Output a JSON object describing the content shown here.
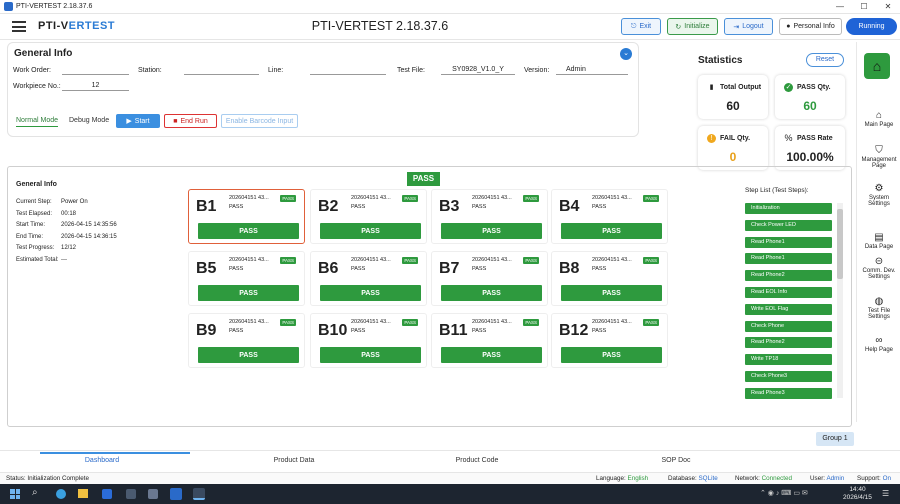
{
  "window": {
    "title": "PTI-VERTEST 2.18.37.6",
    "min": "—",
    "max": "☐",
    "close": "✕"
  },
  "header": {
    "logo_prefix": "PTI-V",
    "logo_suffix": "ERTEST",
    "app_title": "PTI-VERTEST 2.18.37.6",
    "buttons": {
      "exit": "Exit",
      "initialize": "Initialize",
      "logout": "Logout",
      "personal_info": "Personal Info",
      "running": "Running"
    }
  },
  "general_info": {
    "title": "General Info",
    "work_order_label": "Work Order:",
    "work_order": "",
    "station_label": "Station:",
    "station": "",
    "line_label": "Line:",
    "line": "",
    "test_file_label": "Test File:",
    "test_file": "SY0928_V1.0_Y",
    "version_label": "Version:",
    "version": "Admin",
    "workpiece_label": "Workpiece No.:",
    "workpiece": "12"
  },
  "statistics": {
    "title": "Statistics",
    "reset": "Reset",
    "total_output_label": "Total Output",
    "total_output": "60",
    "pass_qty_label": "PASS Qty.",
    "pass_qty": "60",
    "fail_qty_label": "FAIL Qty.",
    "fail_qty": "0",
    "pass_rate_label": "PASS Rate",
    "pass_rate": "100.00%"
  },
  "modes": {
    "normal": "Normal Mode",
    "debug": "Debug Mode",
    "start": "Start",
    "end_run": "End Run",
    "barcode": "Enable Barcode Input"
  },
  "overall_status": "PASS",
  "run_info": {
    "title": "General Info",
    "current_step_label": "Current Step:",
    "current_step": "Power On",
    "elapsed_label": "Test Elapsed:",
    "elapsed": "00:18",
    "start_label": "Start Time:",
    "start": "2026-04-15 14:35:56",
    "end_label": "End Time:",
    "end": "2026-04-15 14:36:15",
    "progress_label": "Test Progress:",
    "progress": "12/12",
    "estimated_label": "Estimated Total:",
    "estimated": "---"
  },
  "slots": [
    {
      "name": "B1",
      "serial": "202604151 43...",
      "status": "PASS",
      "tag": "PASS",
      "result": "PASS"
    },
    {
      "name": "B2",
      "serial": "202604151 43...",
      "status": "PASS",
      "tag": "PASS",
      "result": "PASS"
    },
    {
      "name": "B3",
      "serial": "202604151 43...",
      "status": "PASS",
      "tag": "PASS",
      "result": "PASS"
    },
    {
      "name": "B4",
      "serial": "202604151 43...",
      "status": "PASS",
      "tag": "PASS",
      "result": "PASS"
    },
    {
      "name": "B5",
      "serial": "202604151 43...",
      "status": "PASS",
      "tag": "PASS",
      "result": "PASS"
    },
    {
      "name": "B6",
      "serial": "202604151 43...",
      "status": "PASS",
      "tag": "PASS",
      "result": "PASS"
    },
    {
      "name": "B7",
      "serial": "202604151 43...",
      "status": "PASS",
      "tag": "PASS",
      "result": "PASS"
    },
    {
      "name": "B8",
      "serial": "202604151 43...",
      "status": "PASS",
      "tag": "PASS",
      "result": "PASS"
    },
    {
      "name": "B9",
      "serial": "202604151 43...",
      "status": "PASS",
      "tag": "PASS",
      "result": "PASS"
    },
    {
      "name": "B10",
      "serial": "202604151 43...",
      "status": "PASS",
      "tag": "PASS",
      "result": "PASS"
    },
    {
      "name": "B11",
      "serial": "202604151 43...",
      "status": "PASS",
      "tag": "PASS",
      "result": "PASS"
    },
    {
      "name": "B12",
      "serial": "202604151 43...",
      "status": "PASS",
      "tag": "PASS",
      "result": "PASS"
    }
  ],
  "step_list": {
    "title": "Step List (Test Steps):",
    "steps": [
      "Initialization",
      "Check Power LED",
      "Read Phone1",
      "Read Phone1",
      "Read Phone2",
      "Read EOL Info",
      "Write EOL Flag",
      "Check Phone",
      "Read Phone2",
      "Write TP18",
      "Check Phone3",
      "Read Phone3"
    ]
  },
  "group_button": "Group 1",
  "sidebar": [
    {
      "label": "Main Page",
      "icon": "home-icon",
      "glyph": "⌂"
    },
    {
      "label": "Management Page",
      "icon": "shield-icon",
      "glyph": "⛉"
    },
    {
      "label": "System Settings",
      "icon": "gear-icon",
      "glyph": "⚙"
    },
    {
      "label": "Data Page",
      "icon": "database-icon",
      "glyph": "▤"
    },
    {
      "label": "Comm. Dev. Settings",
      "icon": "toggle-icon",
      "glyph": "⊝"
    },
    {
      "label": "Test File Settings",
      "icon": "palette-icon",
      "glyph": "◍"
    },
    {
      "label": "Help Page",
      "icon": "link-icon",
      "glyph": "∞"
    }
  ],
  "tabs": [
    "Dashboard",
    "Product Data",
    "Product Code",
    "SOP Doc"
  ],
  "status_bar": {
    "status_label": "Status:",
    "status": "Initialization Complete",
    "language_label": "Language:",
    "language": "English",
    "database_label": "Database:",
    "database": "SQLite",
    "network_label": "Network:",
    "network": "Connected",
    "user_label": "User:",
    "user": "Admin",
    "support_label": "Support:",
    "support": "On"
  },
  "taskbar": {
    "time": "14:40",
    "date": "2026/4/15"
  },
  "colors": {
    "pass_green": "#2e9a3e",
    "accent_blue": "#1f63d6",
    "home_green": "#2e9a3e"
  }
}
